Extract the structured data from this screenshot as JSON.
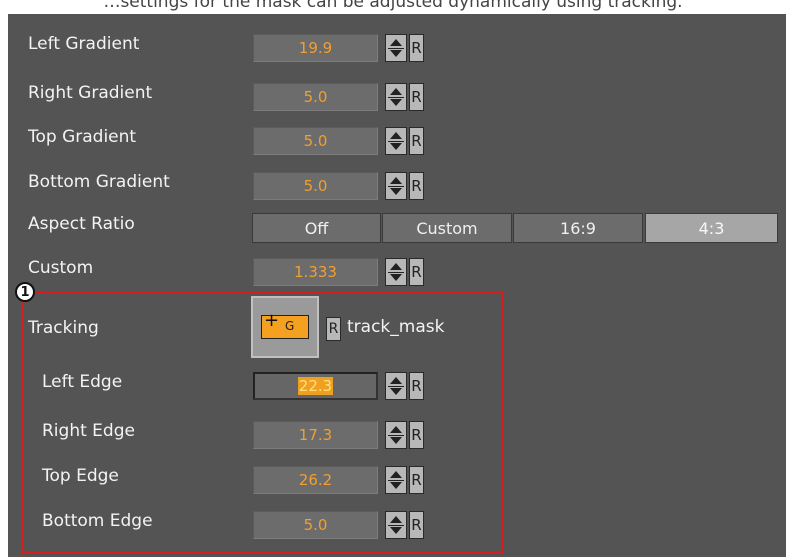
{
  "caption": "…settings for the mask can be adjusted dynamically using tracking.",
  "rows": [
    {
      "label": "Left Gradient",
      "value": "19.9"
    },
    {
      "label": "Right Gradient",
      "value": "5.0"
    },
    {
      "label": "Top Gradient",
      "value": "5.0"
    },
    {
      "label": "Bottom Gradient",
      "value": "5.0"
    }
  ],
  "aspect": {
    "label": "Aspect Ratio",
    "options": [
      "Off",
      "Custom",
      "16:9",
      "4:3"
    ],
    "selected": "4:3"
  },
  "custom": {
    "label": "Custom",
    "value": "1.333"
  },
  "reset_label": "R",
  "callout": "1",
  "tracking": {
    "label": "Tracking",
    "icon_letter": "G",
    "target": "track_mask",
    "edges": [
      {
        "label": "Left Edge",
        "value": "22.3"
      },
      {
        "label": "Right Edge",
        "value": "17.3"
      },
      {
        "label": "Top Edge",
        "value": "26.2"
      },
      {
        "label": "Bottom Edge",
        "value": "5.0"
      }
    ]
  },
  "colors": {
    "value_text": "#f0a030",
    "highlight": "#d61e1e",
    "panel": "#545454"
  }
}
